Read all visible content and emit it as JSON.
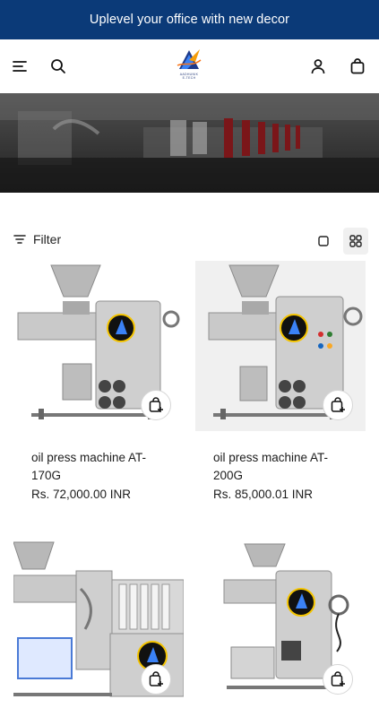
{
  "announcement": {
    "text": "Uplevel your office with new decor"
  },
  "header": {
    "logo_line1": "AADHUNIK",
    "logo_line2": "E-TECH"
  },
  "toolbar": {
    "filter_label": "Filter"
  },
  "products": [
    {
      "title": "oil press machine AT-170G",
      "price": "Rs. 72,000.00 INR"
    },
    {
      "title": "oil press machine AT-200G",
      "price": "Rs. 85,000.01 INR"
    },
    {
      "title": "",
      "price": ""
    },
    {
      "title": "",
      "price": ""
    }
  ],
  "colors": {
    "announcement_bg": "#0b3a78",
    "text": "#1c1c1c",
    "grid_toggle_bg": "#f0f0f0"
  },
  "icons": [
    "menu-icon",
    "search-icon",
    "account-icon",
    "cart-icon",
    "filter-icon",
    "single-view-icon",
    "grid-view-icon",
    "quick-add-bag-icon"
  ]
}
